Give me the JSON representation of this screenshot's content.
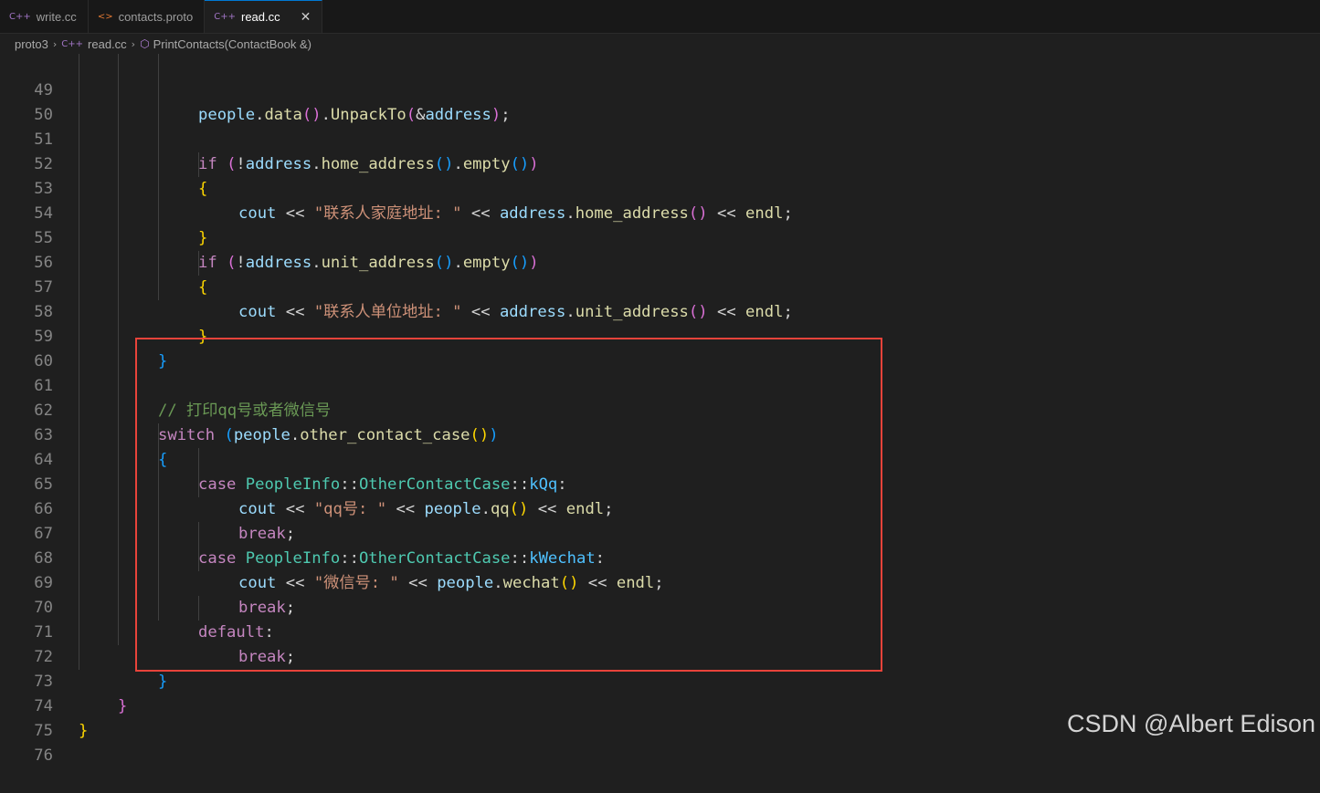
{
  "tabs": [
    {
      "icon": "C++",
      "label": "write.cc",
      "active": false
    },
    {
      "icon": "<>",
      "label": "contacts.proto",
      "active": false
    },
    {
      "icon": "C++",
      "label": "read.cc",
      "active": true
    }
  ],
  "breadcrumb": {
    "folder": "proto3",
    "file": "read.cc",
    "symbol": "PrintContacts(ContactBook &)"
  },
  "line_numbers": [
    "49",
    "50",
    "51",
    "52",
    "53",
    "54",
    "55",
    "56",
    "57",
    "58",
    "59",
    "60",
    "61",
    "62",
    "63",
    "64",
    "65",
    "66",
    "67",
    "68",
    "69",
    "70",
    "71",
    "72",
    "73",
    "74",
    "75",
    "76"
  ],
  "code": {
    "l49": {
      "obj": "people",
      "dot1": ".",
      "m1": "data",
      "p1": "()",
      "dot2": ".",
      "m2": "UnpackTo",
      "p2": "(",
      "amp": "&",
      "arg": "address",
      "p3": ")",
      "semi": ";"
    },
    "l51": {
      "kw": "if",
      "open": "(",
      "bang": "!",
      "obj": "address",
      "dot1": ".",
      "m1": "home_address",
      "p1": "()",
      "dot2": ".",
      "m2": "empty",
      "p2": "()",
      "close": ")"
    },
    "l52": "{",
    "l53": {
      "cout": "cout",
      "op1": " << ",
      "str": "\"联系人家庭地址: \"",
      "op2": " << ",
      "obj": "address",
      "dot": ".",
      "m": "home_address",
      "p": "()",
      "op3": " << ",
      "endl": "endl",
      "semi": ";"
    },
    "l54": "}",
    "l55": {
      "kw": "if",
      "open": "(",
      "bang": "!",
      "obj": "address",
      "dot1": ".",
      "m1": "unit_address",
      "p1": "()",
      "dot2": ".",
      "m2": "empty",
      "p2": "()",
      "close": ")"
    },
    "l56": "{",
    "l57": {
      "cout": "cout",
      "op1": " << ",
      "str": "\"联系人单位地址: \"",
      "op2": " << ",
      "obj": "address",
      "dot": ".",
      "m": "unit_address",
      "p": "()",
      "op3": " << ",
      "endl": "endl",
      "semi": ";"
    },
    "l58": "}",
    "l59": "}",
    "l61": "// 打印qq号或者微信号",
    "l62": {
      "kw": "switch",
      "open": "(",
      "obj": "people",
      "dot": ".",
      "m": "other_contact_case",
      "p": "()",
      "close": ")"
    },
    "l63": "{",
    "l64": {
      "kw": "case",
      "t1": "PeopleInfo",
      "sep1": "::",
      "t2": "OtherContactCase",
      "sep2": "::",
      "e": "kQq",
      "colon": ":"
    },
    "l65": {
      "cout": "cout",
      "op1": " << ",
      "str": "\"qq号: \"",
      "op2": " << ",
      "obj": "people",
      "dot": ".",
      "m": "qq",
      "p": "()",
      "op3": " << ",
      "endl": "endl",
      "semi": ";"
    },
    "l66": {
      "kw": "break",
      "semi": ";"
    },
    "l67": {
      "kw": "case",
      "t1": "PeopleInfo",
      "sep1": "::",
      "t2": "OtherContactCase",
      "sep2": "::",
      "e": "kWechat",
      "colon": ":"
    },
    "l68": {
      "cout": "cout",
      "op1": " << ",
      "str": "\"微信号: \"",
      "op2": " << ",
      "obj": "people",
      "dot": ".",
      "m": "wechat",
      "p": "()",
      "op3": " << ",
      "endl": "endl",
      "semi": ";"
    },
    "l69": {
      "kw": "break",
      "semi": ";"
    },
    "l70": {
      "kw": "default",
      "colon": ":"
    },
    "l71": {
      "kw": "break",
      "semi": ";"
    },
    "l72": "}",
    "l73": "}",
    "l74": "}"
  },
  "watermark": "CSDN @Albert Edison",
  "colors": {
    "background": "#1f1f1f",
    "keyword": "#c586c0",
    "variable": "#9cdcfe",
    "function": "#dcdcaa",
    "string": "#ce9178",
    "comment": "#6a9955",
    "type": "#4ec9b0",
    "enum_member": "#4fc1ff",
    "highlight_box": "#e8433a"
  }
}
